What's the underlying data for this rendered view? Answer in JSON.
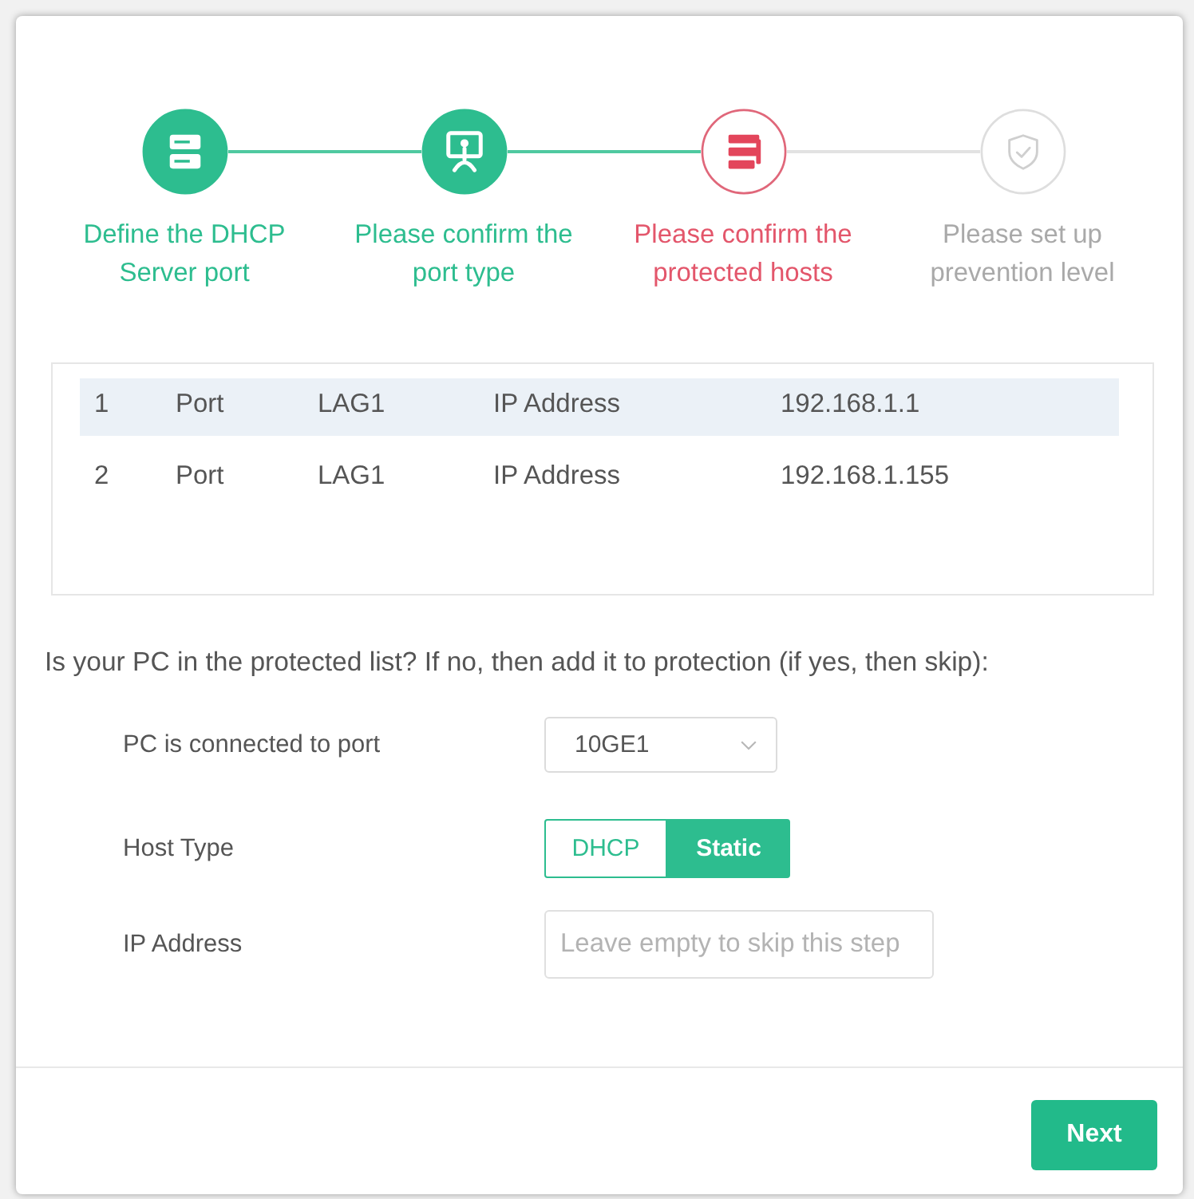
{
  "steps": [
    {
      "label": "Define the DHCP Server port",
      "done": true,
      "active": false
    },
    {
      "label": "Please confirm the port type",
      "done": true,
      "active": false
    },
    {
      "label": "Please confirm the protected hosts",
      "done": false,
      "active": true
    },
    {
      "label": "Please set up prevention level",
      "done": false,
      "active": false
    }
  ],
  "hosts_table": {
    "rows": [
      {
        "selected": true,
        "cells": [
          "1",
          "Port",
          "LAG1",
          "IP Address",
          "192.168.1.1"
        ]
      },
      {
        "selected": false,
        "cells": [
          "2",
          "Port",
          "LAG1",
          "IP Address",
          "192.168.1.155"
        ]
      }
    ]
  },
  "prompt": "Is your PC in the protected list? If no, then add it to protection (if yes, then skip):",
  "form": [
    {
      "kind": "select",
      "label": "PC is connected to port",
      "value": "10GE1"
    },
    {
      "kind": "segmented",
      "label": "Host Type",
      "options": [
        {
          "label": "DHCP",
          "selected": false
        },
        {
          "label": "Static",
          "selected": true
        }
      ]
    },
    {
      "kind": "text",
      "label": "IP Address",
      "placeholder": "Leave empty to skip this step"
    }
  ],
  "next_button": {
    "label": "Next"
  }
}
